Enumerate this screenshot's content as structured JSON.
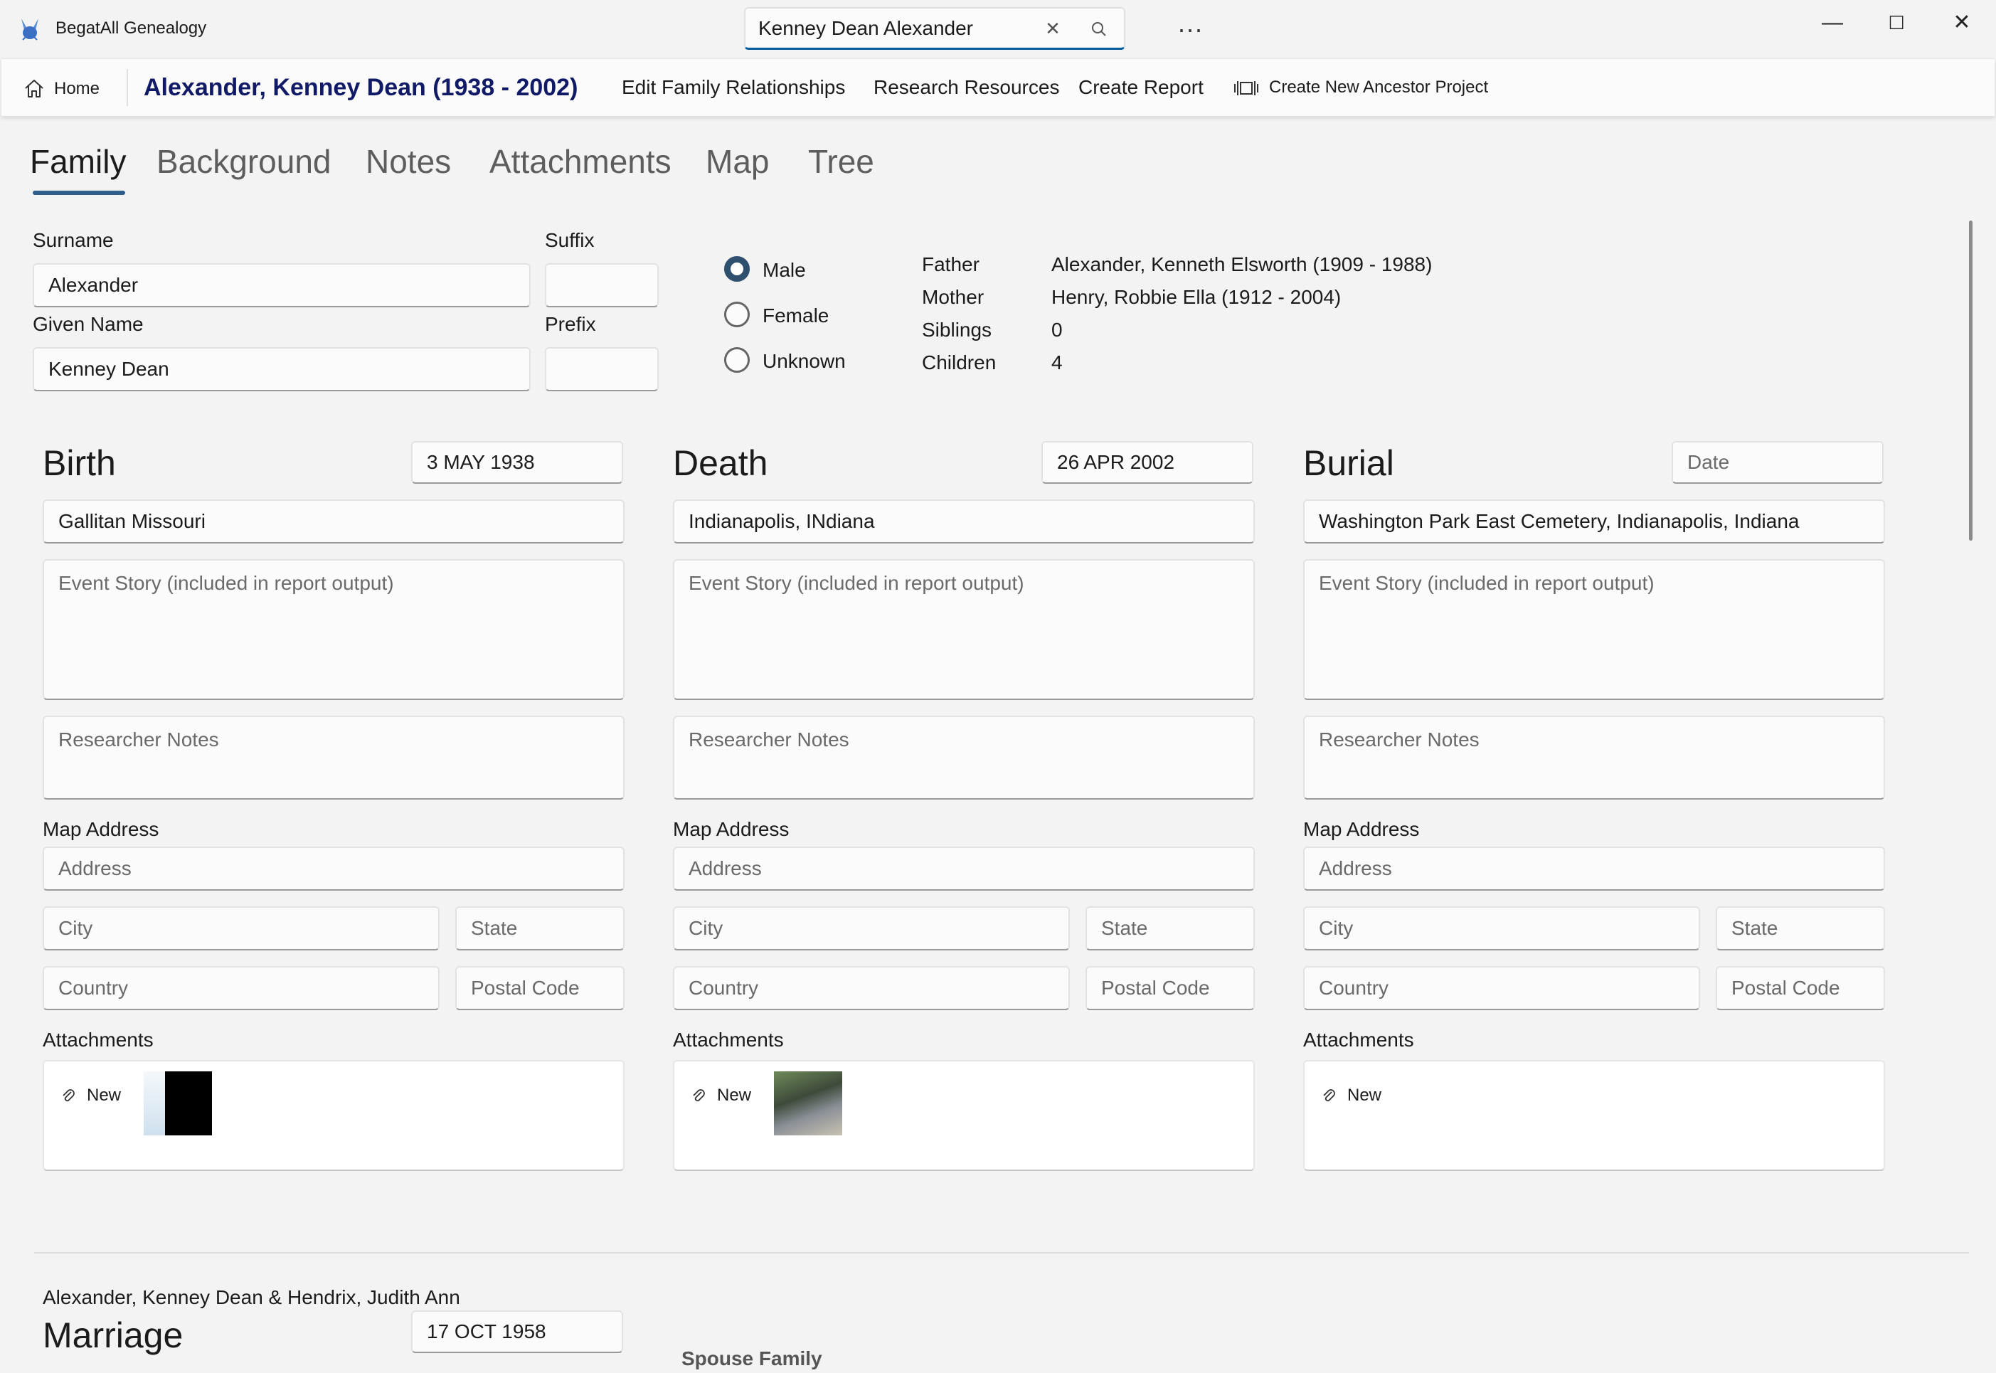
{
  "app": {
    "title": "BegatAll Genealogy",
    "search_value": "Kenney Dean Alexander",
    "more_label": "...",
    "window_controls": {
      "minimize": "—",
      "maximize": "☐",
      "close": "✕"
    }
  },
  "commands": {
    "home": "Home",
    "person_title": "Alexander, Kenney Dean (1938 - 2002)",
    "edit_relationships": "Edit Family Relationships",
    "research_resources": "Research Resources",
    "create_report": "Create Report",
    "create_project": "Create New Ancestor Project"
  },
  "tabs": [
    "Family",
    "Background",
    "Notes",
    "Attachments",
    "Map",
    "Tree"
  ],
  "person": {
    "surname_label": "Surname",
    "surname": "Alexander",
    "suffix_label": "Suffix",
    "suffix": "",
    "given_label": "Given Name",
    "given": "Kenney Dean",
    "prefix_label": "Prefix",
    "prefix": "",
    "gender_options": [
      "Male",
      "Female",
      "Unknown"
    ],
    "gender_selected": "Male"
  },
  "relations": [
    {
      "label": "Father",
      "value": "Alexander, Kenneth Elsworth (1909 - 1988)"
    },
    {
      "label": "Mother",
      "value": "Henry, Robbie Ella (1912 - 2004)"
    },
    {
      "label": "Siblings",
      "value": "0"
    },
    {
      "label": "Children",
      "value": "4"
    }
  ],
  "placeholders": {
    "date": "Date",
    "event_story": "Event Story (included in report output)",
    "researcher_notes": "Researcher Notes",
    "address": "Address",
    "city": "City",
    "state": "State",
    "country": "Country",
    "postal": "Postal Code"
  },
  "labels": {
    "map_address": "Map Address",
    "attachments": "Attachments",
    "new": "New"
  },
  "events": [
    {
      "title": "Birth",
      "date": "3 MAY 1938",
      "place": "Gallitan Missouri",
      "attachment_count": 1
    },
    {
      "title": "Death",
      "date": "26 APR 2002",
      "place": "Indianapolis, INdiana",
      "attachment_count": 1
    },
    {
      "title": "Burial",
      "date": "",
      "place": "Washington Park East Cemetery, Indianapolis, Indiana",
      "attachment_count": 0
    }
  ],
  "marriage": {
    "couple": "Alexander, Kenney Dean & Hendrix, Judith Ann",
    "title": "Marriage",
    "date": "17 OCT 1958",
    "spouse_family_label": "Spouse Family"
  },
  "colors": {
    "accent": "#2f5d8c",
    "title": "#111a66",
    "search_underline": "#005a9e"
  }
}
